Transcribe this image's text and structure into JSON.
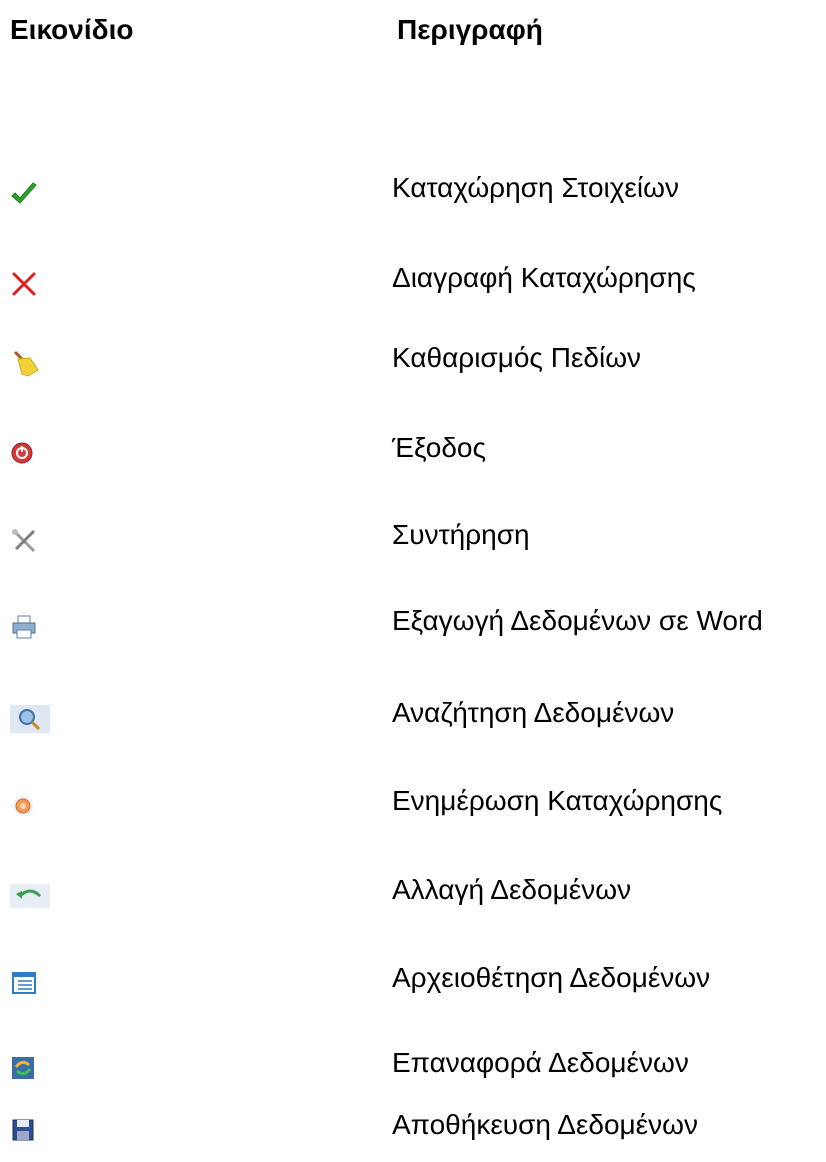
{
  "headers": {
    "icon": "Εικονίδιο",
    "description": "Περιγραφή"
  },
  "rows": [
    {
      "icon": "checkmark-icon",
      "label": "Καταχώρηση Στοιχείων"
    },
    {
      "icon": "delete-x-icon",
      "label": "Διαγραφή  Καταχώρησης"
    },
    {
      "icon": "broom-icon",
      "label": "Καθαρισμός Πεδίων"
    },
    {
      "icon": "exit-icon",
      "label": "Έξοδος"
    },
    {
      "icon": "tools-icon",
      "label": "Συντήρηση"
    },
    {
      "icon": "printer-icon",
      "label": "Εξαγωγή Δεδομένων σε Word"
    },
    {
      "icon": "magnifier-icon",
      "label": "Αναζήτηση Δεδομένων"
    },
    {
      "icon": "update-icon",
      "label": "Ενημέρωση Καταχώρησης"
    },
    {
      "icon": "undo-arrow-icon",
      "label": "Αλλαγή Δεδομένων"
    },
    {
      "icon": "archive-list-icon",
      "label": "Αρχειοθέτηση Δεδομένων"
    },
    {
      "icon": "restore-icon",
      "label": "Επαναφορά Δεδομένων"
    },
    {
      "icon": "floppy-disk-icon",
      "label": "Αποθήκευση Δεδομένων"
    }
  ]
}
